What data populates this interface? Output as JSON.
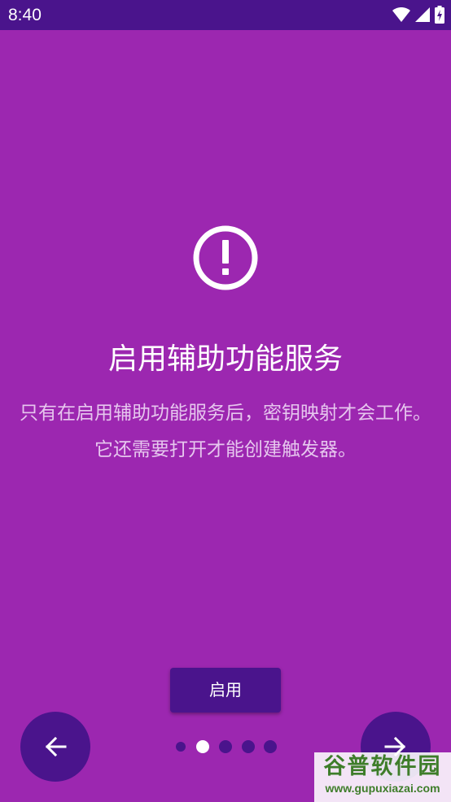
{
  "status_bar": {
    "time": "8:40",
    "icons": [
      "wifi-icon",
      "signal-icon",
      "battery-icon"
    ]
  },
  "main": {
    "icon": "alert-circle-icon",
    "title": "启用辅助功能服务",
    "description": "只有在启用辅助功能服务后，密钥映射才会工作。它还需要打开才能创建触发器。",
    "enable_button_label": "启用"
  },
  "navigation": {
    "prev_icon": "arrow-left-icon",
    "next_icon": "arrow-right-icon",
    "page_indicator": {
      "count": 5,
      "active_index": 1
    }
  },
  "watermark": {
    "name": "谷普软件园",
    "url": "www.gupuxiazai.com"
  },
  "colors": {
    "background": "#9c27b0",
    "accent_dark": "#4a148c",
    "text_primary": "#ffffff",
    "text_secondary": "#e6c6ee"
  }
}
